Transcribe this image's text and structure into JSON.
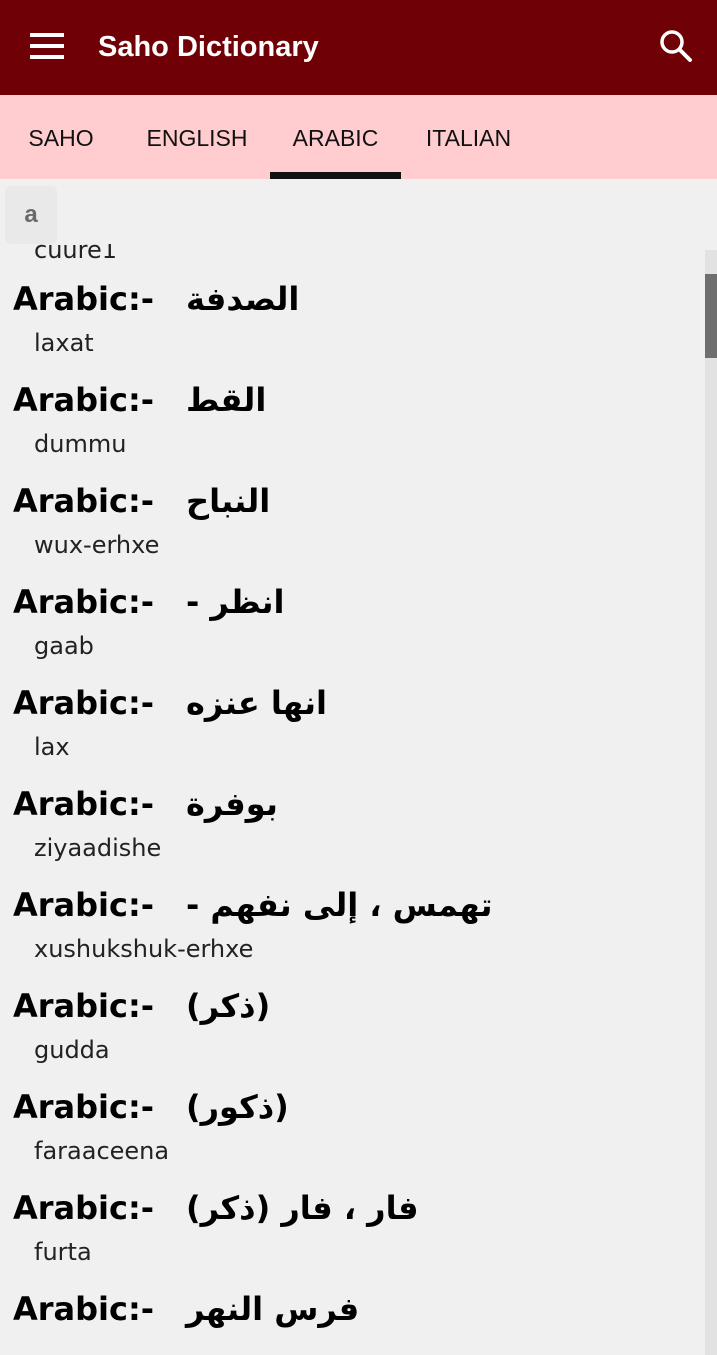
{
  "app_bar": {
    "title": "Saho Dictionary",
    "menu_icon": "hamburger-menu-icon",
    "search_icon": "search-icon",
    "background": "#6e0006"
  },
  "tabs": [
    {
      "label": "SAHO",
      "selected": false
    },
    {
      "label": "ENGLISH",
      "selected": false
    },
    {
      "label": "ARABIC",
      "selected": true
    },
    {
      "label": "ITALIAN",
      "selected": false
    }
  ],
  "tab_bar_color": "#ffccd0",
  "letter_filter": "a",
  "list": {
    "partial_top_word": "cuure1",
    "entry_label": "Arabic:-",
    "entries": [
      {
        "arabic": "الصدفة",
        "saho": "laxat"
      },
      {
        "arabic": "القط",
        "saho": "dummu"
      },
      {
        "arabic": "النباح",
        "saho": "wux-erhxe"
      },
      {
        "arabic": "انظر -",
        "saho": "gaab"
      },
      {
        "arabic": "انها عنزه",
        "saho": "lax"
      },
      {
        "arabic": "بوفرة",
        "saho": "ziyaadishe"
      },
      {
        "arabic": "تهمس ، إلى نفهم  -",
        "saho": "xushukshuk-erhxe"
      },
      {
        "arabic": "(ذكر)",
        "saho": "gudda"
      },
      {
        "arabic": "(ذكور)",
        "saho": "faraaceena"
      },
      {
        "arabic": "فار ، فار (ذكر)",
        "saho": "furta"
      },
      {
        "arabic": "فرس النهر",
        "saho": ""
      }
    ]
  }
}
